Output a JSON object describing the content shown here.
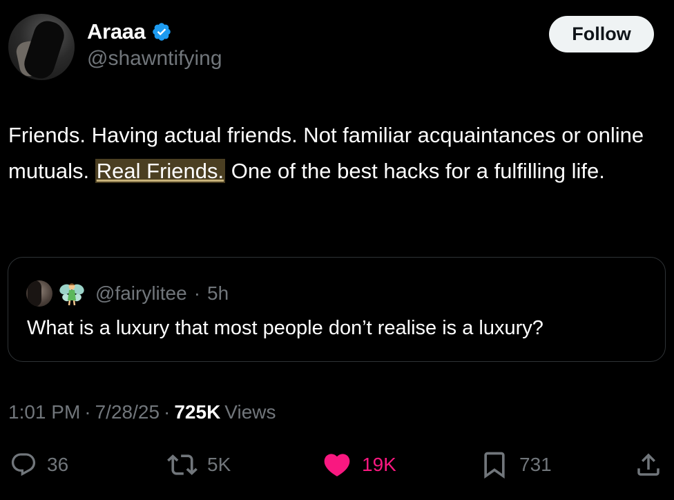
{
  "author": {
    "display_name": "Araaa",
    "handle": "@shawntifying",
    "verified_color": "#1d9bf0"
  },
  "follow_button": {
    "label": "Follow"
  },
  "tweet": {
    "text_before": "Friends. Having actual friends. Not familiar acquaintances or online mutuals. ",
    "text_highlight": "Real Friends.",
    "text_after": " One of the best hacks for a fulfilling life.",
    "highlight_color": "#4b3f22"
  },
  "quoted_tweet": {
    "handle": "@fairylitee",
    "separator": "·",
    "age": "5h",
    "text": "What is a luxury that most people don’t realise is a luxury?"
  },
  "meta": {
    "time": "1:01 PM",
    "separator_1": "·",
    "date": "7/28/25",
    "separator_2": "·",
    "views_count": "725K",
    "views_label": "Views"
  },
  "actions": {
    "replies": "36",
    "reposts": "5K",
    "likes": "19K",
    "bookmarks": "731",
    "like_color": "#f91880",
    "icons": [
      "reply-icon",
      "repost-icon",
      "heart-icon",
      "bookmark-icon",
      "share-icon"
    ]
  }
}
